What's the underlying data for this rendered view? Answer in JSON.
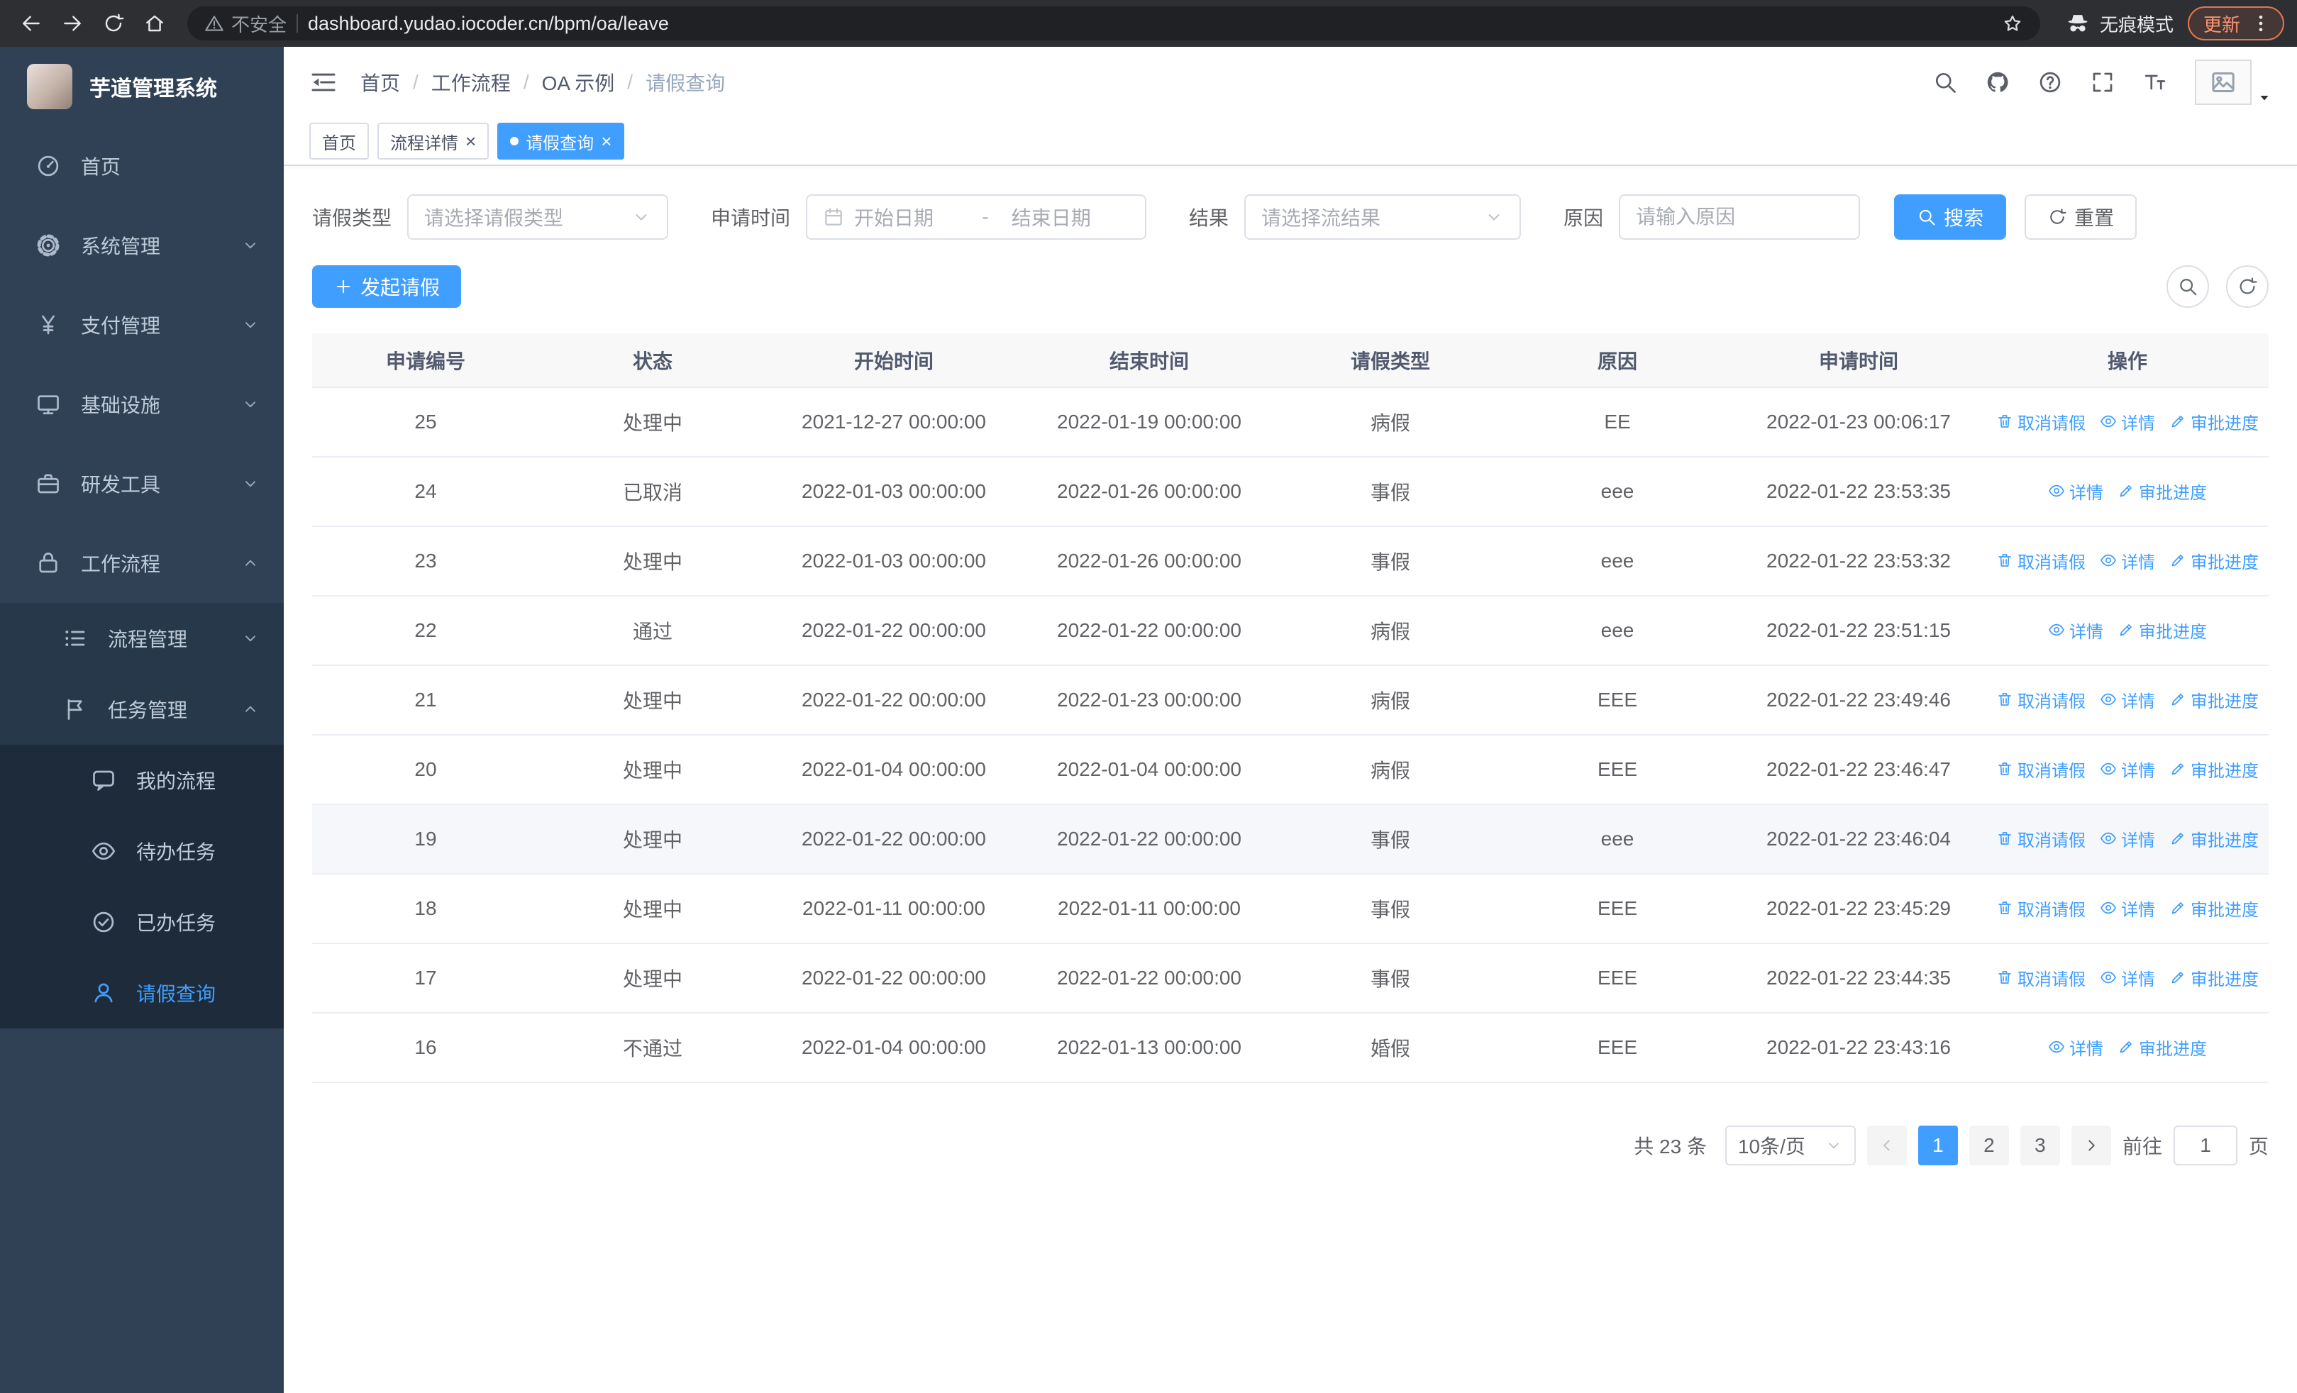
{
  "browser": {
    "security_label": "不安全",
    "url": "dashboard.yudao.iocoder.cn/bpm/oa/leave",
    "incognito_label": "无痕模式",
    "update_label": "更新"
  },
  "icons": {
    "close_glyph": "×"
  },
  "sidebar": {
    "title": "芋道管理系统",
    "items": [
      {
        "label": "首页",
        "icon": "dashboard-icon",
        "level": 1
      },
      {
        "label": "系统管理",
        "icon": "gear-icon",
        "level": 1,
        "chevron": "down"
      },
      {
        "label": "支付管理",
        "icon": "yen-icon",
        "level": 1,
        "chevron": "down"
      },
      {
        "label": "基础设施",
        "icon": "monitor-icon",
        "level": 1,
        "chevron": "down"
      },
      {
        "label": "研发工具",
        "icon": "briefcase-icon",
        "level": 1,
        "chevron": "down"
      },
      {
        "label": "工作流程",
        "icon": "workflow-bag-icon",
        "level": 1,
        "chevron": "up",
        "expanded": true
      },
      {
        "label": "流程管理",
        "icon": "process-list-icon",
        "level": 2,
        "chevron": "down"
      },
      {
        "label": "任务管理",
        "icon": "task-flag-icon",
        "level": 2,
        "chevron": "up",
        "expanded": true
      },
      {
        "label": "我的流程",
        "icon": "chat-icon",
        "level": 3
      },
      {
        "label": "待办任务",
        "icon": "eye-icon",
        "level": 3
      },
      {
        "label": "已办任务",
        "icon": "check-circle-icon",
        "level": 3
      },
      {
        "label": "请假查询",
        "icon": "user-icon",
        "level": 3,
        "active": true
      }
    ]
  },
  "header": {
    "separator": "/",
    "breadcrumb": [
      "首页",
      "工作流程",
      "OA 示例",
      "请假查询"
    ]
  },
  "tabs": [
    {
      "label": "首页",
      "closable": false,
      "active": false
    },
    {
      "label": "流程详情",
      "closable": true,
      "active": false
    },
    {
      "label": "请假查询",
      "closable": true,
      "active": true
    }
  ],
  "filters": {
    "type_label": "请假类型",
    "type_placeholder": "请选择请假类型",
    "time_label": "申请时间",
    "start_placeholder": "开始日期",
    "separator": "-",
    "end_placeholder": "结束日期",
    "result_label": "结果",
    "result_placeholder": "请选择流结果",
    "reason_label": "原因",
    "reason_placeholder": "请输入原因",
    "search_label": "搜索",
    "reset_label": "重置"
  },
  "toolbar": {
    "create_label": "发起请假"
  },
  "table": {
    "headers": [
      "申请编号",
      "状态",
      "开始时间",
      "结束时间",
      "请假类型",
      "原因",
      "申请时间",
      "操作"
    ],
    "ops_labels": {
      "cancel": "取消请假",
      "detail": "详情",
      "progress": "审批进度"
    },
    "rows": [
      {
        "id": "25",
        "status": "处理中",
        "start": "2021-12-27 00:00:00",
        "end": "2022-01-19 00:00:00",
        "type": "病假",
        "reason": "EE",
        "applied": "2022-01-23 00:06:17",
        "ops": [
          "cancel",
          "detail",
          "progress"
        ]
      },
      {
        "id": "24",
        "status": "已取消",
        "start": "2022-01-03 00:00:00",
        "end": "2022-01-26 00:00:00",
        "type": "事假",
        "reason": "eee",
        "applied": "2022-01-22 23:53:35",
        "ops": [
          "detail",
          "progress"
        ]
      },
      {
        "id": "23",
        "status": "处理中",
        "start": "2022-01-03 00:00:00",
        "end": "2022-01-26 00:00:00",
        "type": "事假",
        "reason": "eee",
        "applied": "2022-01-22 23:53:32",
        "ops": [
          "cancel",
          "detail",
          "progress"
        ]
      },
      {
        "id": "22",
        "status": "通过",
        "start": "2022-01-22 00:00:00",
        "end": "2022-01-22 00:00:00",
        "type": "病假",
        "reason": "eee",
        "applied": "2022-01-22 23:51:15",
        "ops": [
          "detail",
          "progress"
        ]
      },
      {
        "id": "21",
        "status": "处理中",
        "start": "2022-01-22 00:00:00",
        "end": "2022-01-23 00:00:00",
        "type": "病假",
        "reason": "EEE",
        "applied": "2022-01-22 23:49:46",
        "ops": [
          "cancel",
          "detail",
          "progress"
        ]
      },
      {
        "id": "20",
        "status": "处理中",
        "start": "2022-01-04 00:00:00",
        "end": "2022-01-04 00:00:00",
        "type": "病假",
        "reason": "EEE",
        "applied": "2022-01-22 23:46:47",
        "ops": [
          "cancel",
          "detail",
          "progress"
        ]
      },
      {
        "id": "19",
        "status": "处理中",
        "start": "2022-01-22 00:00:00",
        "end": "2022-01-22 00:00:00",
        "type": "事假",
        "reason": "eee",
        "applied": "2022-01-22 23:46:04",
        "ops": [
          "cancel",
          "detail",
          "progress"
        ],
        "highlight": true
      },
      {
        "id": "18",
        "status": "处理中",
        "start": "2022-01-11 00:00:00",
        "end": "2022-01-11 00:00:00",
        "type": "事假",
        "reason": "EEE",
        "applied": "2022-01-22 23:45:29",
        "ops": [
          "cancel",
          "detail",
          "progress"
        ]
      },
      {
        "id": "17",
        "status": "处理中",
        "start": "2022-01-22 00:00:00",
        "end": "2022-01-22 00:00:00",
        "type": "事假",
        "reason": "EEE",
        "applied": "2022-01-22 23:44:35",
        "ops": [
          "cancel",
          "detail",
          "progress"
        ]
      },
      {
        "id": "16",
        "status": "不通过",
        "start": "2022-01-04 00:00:00",
        "end": "2022-01-13 00:00:00",
        "type": "婚假",
        "reason": "EEE",
        "applied": "2022-01-22 23:43:16",
        "ops": [
          "detail",
          "progress"
        ]
      }
    ]
  },
  "pagination": {
    "total_label": "共 23 条",
    "page_size": "10条/页",
    "pages": [
      "1",
      "2",
      "3"
    ],
    "active_page": "1",
    "goto_label": "前往",
    "goto_value": "1",
    "page_unit": "页"
  },
  "colors": {
    "primary": "#409EFF",
    "sidebar_bg": "#304156",
    "tag_active": "#409EFF"
  }
}
